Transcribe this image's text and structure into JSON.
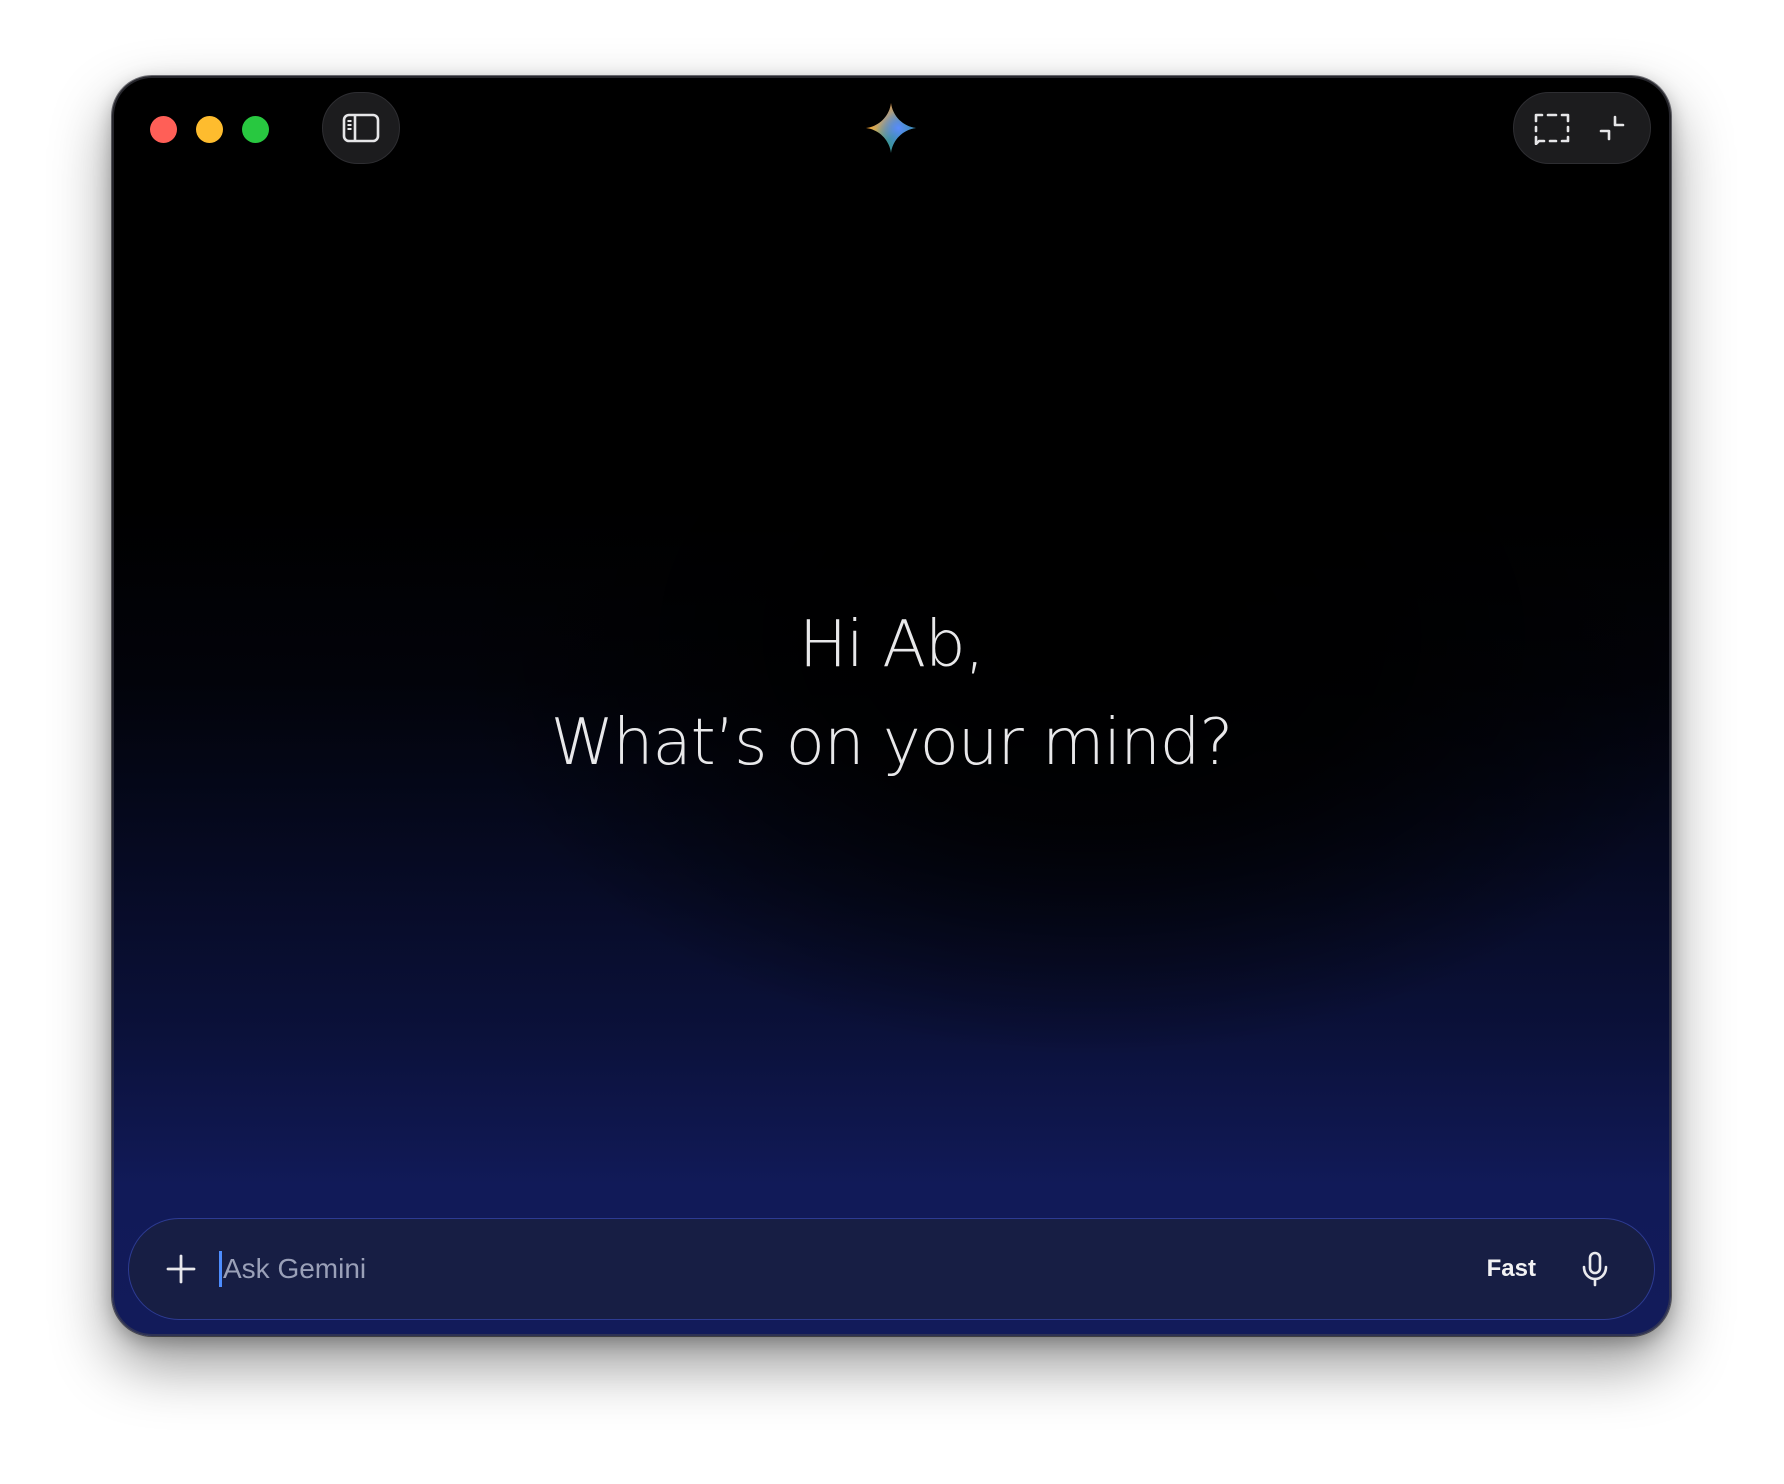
{
  "window": {
    "app": "Gemini"
  },
  "titlebar": {
    "traffic_lights": [
      "close",
      "minimize",
      "zoom"
    ],
    "left_button_icon": "sidebar-toggle-icon",
    "logo_icon": "gemini-sparkle-icon",
    "right_buttons": [
      {
        "icon": "screenshot-region-icon"
      },
      {
        "icon": "collapse-window-icon"
      }
    ]
  },
  "greeting": {
    "line1": "Hi Ab,",
    "line2": "What’s on your mind?"
  },
  "composer": {
    "add_icon": "plus-icon",
    "placeholder": "Ask Gemini",
    "mode_label": "Fast",
    "mic_icon": "microphone-icon"
  },
  "colors": {
    "close": "#ff5f57",
    "minimize": "#febc2e",
    "zoom": "#28c840",
    "caret": "#4d8dff",
    "input_border": "#2d3b92"
  }
}
